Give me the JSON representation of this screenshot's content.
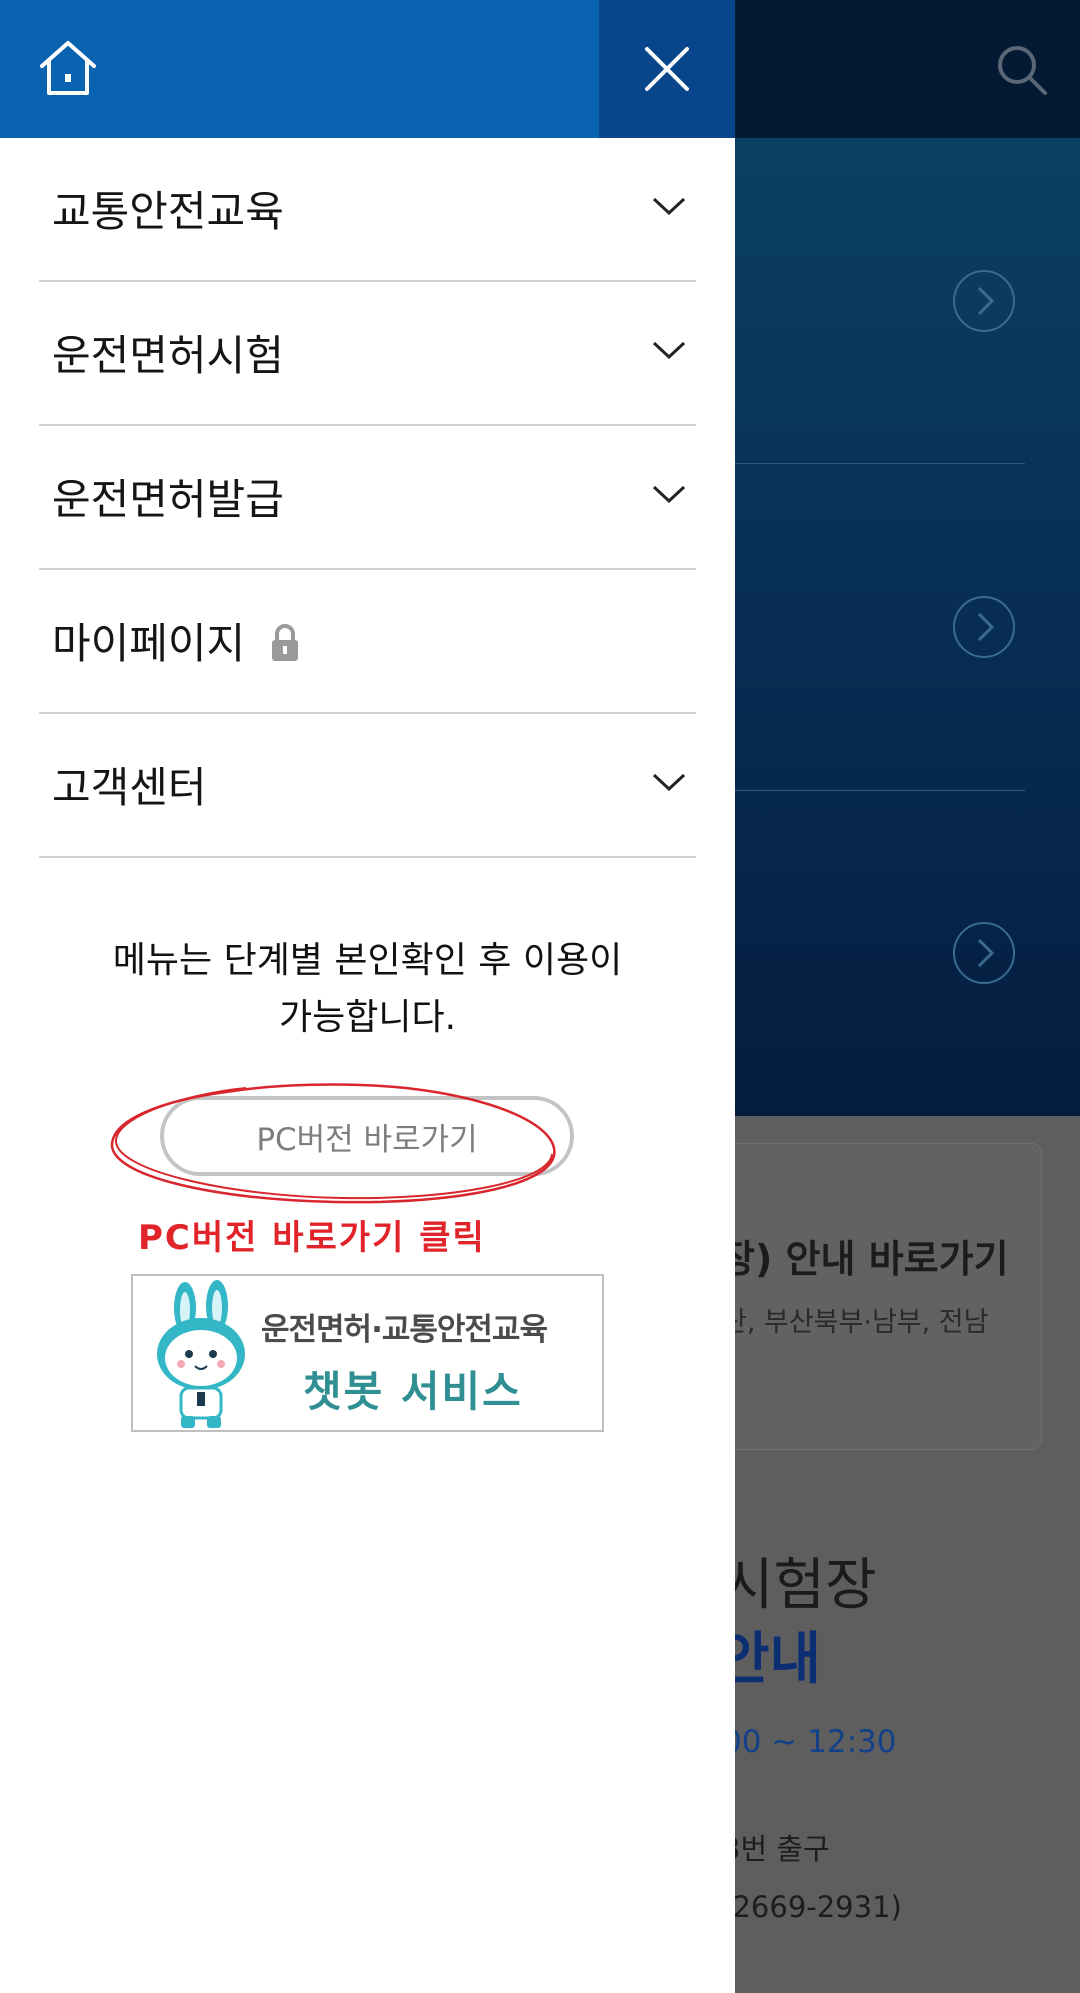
{
  "background": {
    "card_title": "장) 안내 바로가기",
    "card_sub": "산, 부산북부·남부, 전남",
    "exam_title": "시험장",
    "exam_info": "안내",
    "time": "00 ~ 12:30",
    "exit": "3번 출구",
    "phone": "-2669-2931)"
  },
  "drawer": {
    "menu": [
      {
        "label": "교통안전교육",
        "icon": "chevron-down-icon"
      },
      {
        "label": "운전면허시험",
        "icon": "chevron-down-icon"
      },
      {
        "label": "운전면허발급",
        "icon": "chevron-down-icon"
      },
      {
        "label": "마이페이지",
        "icon": "lock-icon"
      },
      {
        "label": "고객센터",
        "icon": "chevron-down-icon"
      }
    ],
    "notice_line1": "메뉴는 단계별 본인확인 후 이용이",
    "notice_line2": "가능합니다.",
    "pc_button": "PC버전 바로가기",
    "annotation": "PC버전 바로가기 클릭",
    "chatbot": {
      "line1": "운전면허·교통안전교육",
      "line2": "챗봇 서비스"
    }
  },
  "colors": {
    "drawer_header": "#0a63b0",
    "close_button_bg": "#08458a",
    "annotation_red": "#e0242a",
    "chatbot_teal": "#2f8f92"
  }
}
